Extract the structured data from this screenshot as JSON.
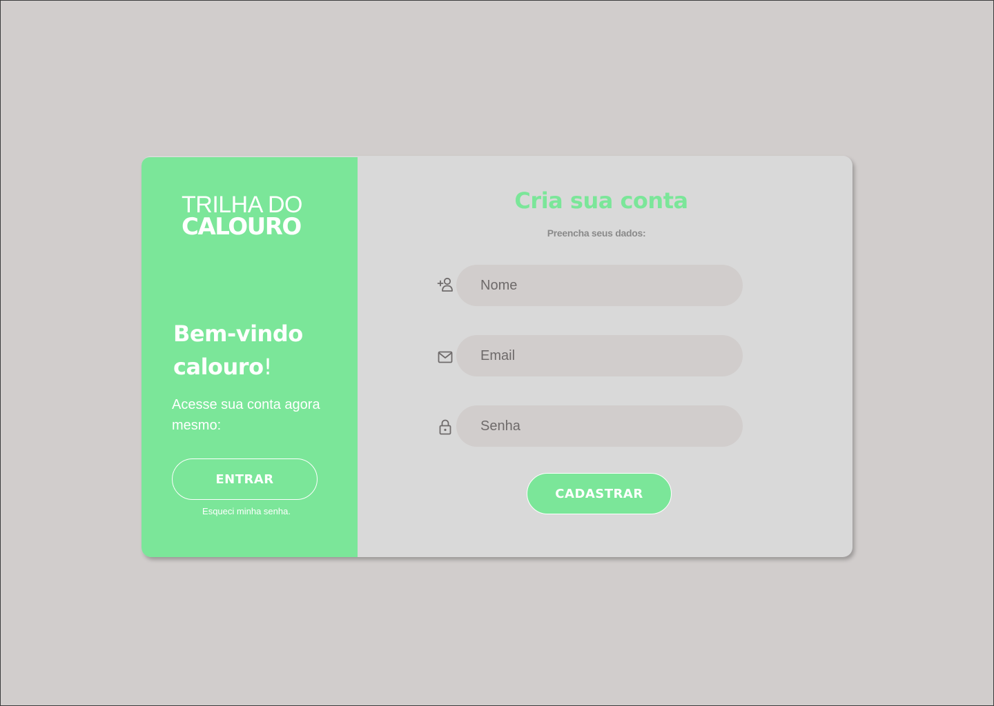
{
  "brand": {
    "logo_top": "TRILHA DO",
    "logo_bottom": "CALOURO"
  },
  "left_panel": {
    "welcome_line1": "Bem-vindo",
    "welcome_line2": "calouro",
    "welcome_excl": "!",
    "subtitle": "Acesse sua conta agora mesmo:",
    "enter_button": "ENTRAR",
    "forgot_link": "Esqueci minha senha."
  },
  "form": {
    "title": "Cria sua conta",
    "subtitle": "Preencha seus dados:",
    "name_placeholder": "Nome",
    "email_placeholder": "Email",
    "password_placeholder": "Senha",
    "register_button": "CADASTRAR",
    "icons": {
      "name": "add-user-icon",
      "email": "mail-icon",
      "password": "lock-icon"
    }
  },
  "colors": {
    "accent": "#7be699",
    "background": "#d1cdcc",
    "card": "#d9d9d9",
    "field": "#d1cdcc",
    "muted_text": "#6e6a6a"
  }
}
